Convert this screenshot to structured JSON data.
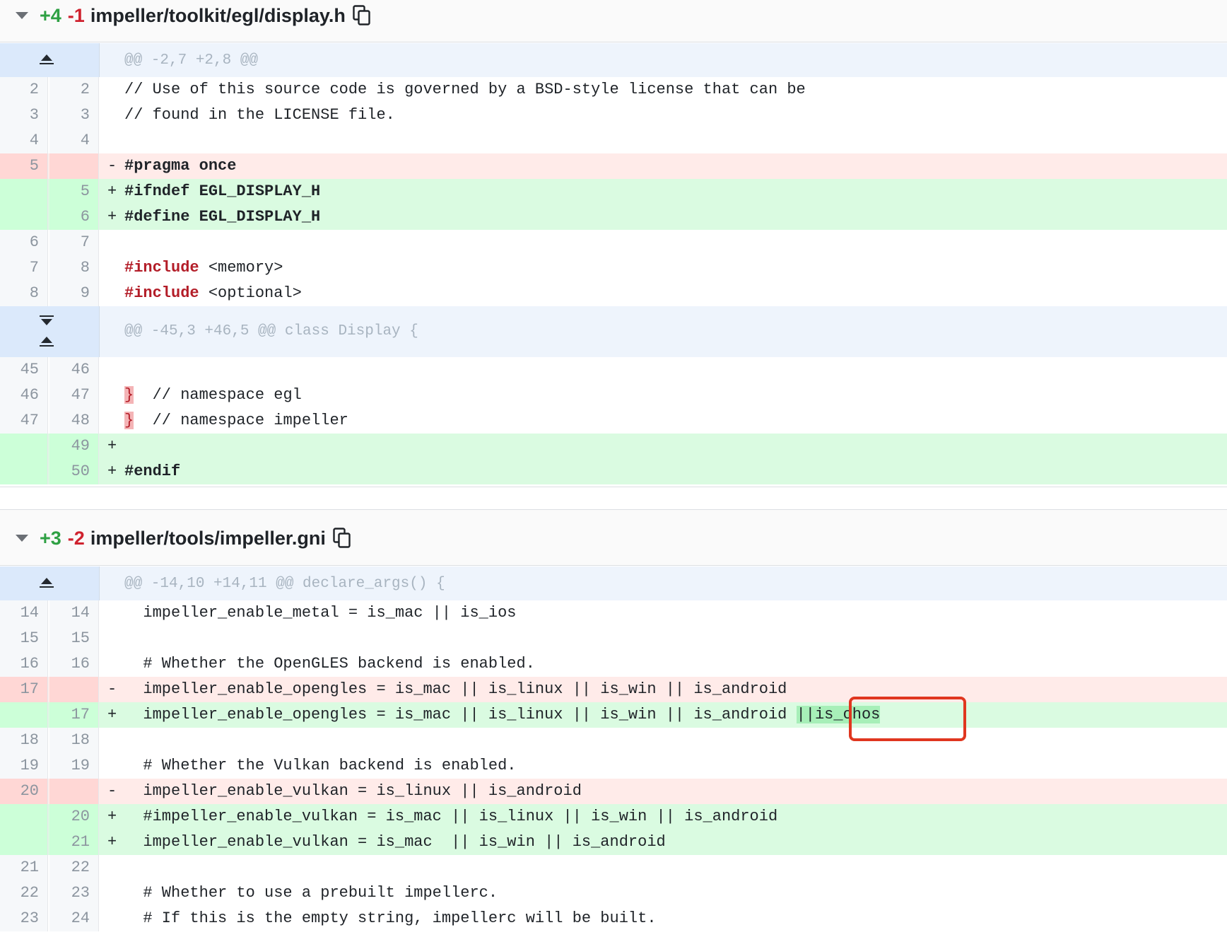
{
  "files": [
    {
      "added": "+4",
      "removed": "-1",
      "name": "impeller/toolkit/egl/display.h",
      "hunks": [
        "@@ -2,7 +2,8 @@",
        "@@ -45,3 +46,5 @@ class Display {"
      ]
    },
    {
      "added": "+3",
      "removed": "-2",
      "name": "impeller/tools/impeller.gni",
      "hunks": [
        "@@ -14,10 +14,11 @@ declare_args() {"
      ]
    }
  ],
  "f1": {
    "r1": {
      "o": "2",
      "n": "2",
      "code": "// Use of this source code is governed by a BSD-style license that can be"
    },
    "r2": {
      "o": "3",
      "n": "3",
      "code": "// found in the LICENSE file."
    },
    "r3": {
      "o": "4",
      "n": "4",
      "code": ""
    },
    "r4": {
      "o": "5",
      "n": "",
      "sign": "-",
      "kw": "#pragma once"
    },
    "r5": {
      "o": "",
      "n": "5",
      "sign": "+",
      "kw": "#ifndef EGL_DISPLAY_H"
    },
    "r6": {
      "o": "",
      "n": "6",
      "sign": "+",
      "kw": "#define EGL_DISPLAY_H"
    },
    "r7": {
      "o": "6",
      "n": "7",
      "code": ""
    },
    "r8": {
      "o": "7",
      "n": "8",
      "kw": "#include",
      "code": " <memory>"
    },
    "r9": {
      "o": "8",
      "n": "9",
      "kw": "#include",
      "code": " <optional>"
    },
    "r10": {
      "o": "45",
      "n": "46",
      "code": ""
    },
    "r11": {
      "o": "46",
      "n": "47",
      "brace": "}",
      "code": "  // namespace egl"
    },
    "r12": {
      "o": "47",
      "n": "48",
      "brace": "}",
      "code": "  // namespace impeller"
    },
    "r13": {
      "o": "",
      "n": "49",
      "sign": "+",
      "code": ""
    },
    "r14": {
      "o": "",
      "n": "50",
      "sign": "+",
      "kw": "#endif"
    }
  },
  "f2": {
    "r1": {
      "o": "14",
      "n": "14",
      "code": "  impeller_enable_metal = is_mac || is_ios"
    },
    "r2": {
      "o": "15",
      "n": "15",
      "code": ""
    },
    "r3": {
      "o": "16",
      "n": "16",
      "code": "  # Whether the OpenGLES backend is enabled."
    },
    "r4": {
      "o": "17",
      "n": "",
      "sign": "-",
      "code": "  impeller_enable_opengles = is_mac || is_linux || is_win || is_android"
    },
    "r5": {
      "o": "",
      "n": "17",
      "sign": "+",
      "code": "  impeller_enable_opengles = is_mac || is_linux || is_win || is_android ",
      "hl": "||is_ohos"
    },
    "r6": {
      "o": "18",
      "n": "18",
      "code": ""
    },
    "r7": {
      "o": "19",
      "n": "19",
      "code": "  # Whether the Vulkan backend is enabled."
    },
    "r8": {
      "o": "20",
      "n": "",
      "sign": "-",
      "code": "  impeller_enable_vulkan = is_linux || is_android"
    },
    "r9": {
      "o": "",
      "n": "20",
      "sign": "+",
      "code": "  #impeller_enable_vulkan = is_mac || is_linux || is_win || is_android"
    },
    "r10": {
      "o": "",
      "n": "21",
      "sign": "+",
      "code": "  impeller_enable_vulkan = is_mac  || is_win || is_android"
    },
    "r11": {
      "o": "21",
      "n": "22",
      "code": ""
    },
    "r12": {
      "o": "22",
      "n": "23",
      "code": "  # Whether to use a prebuilt impellerc."
    },
    "r13": {
      "o": "23",
      "n": "24",
      "code": "  # If this is the empty string, impellerc will be built."
    }
  }
}
